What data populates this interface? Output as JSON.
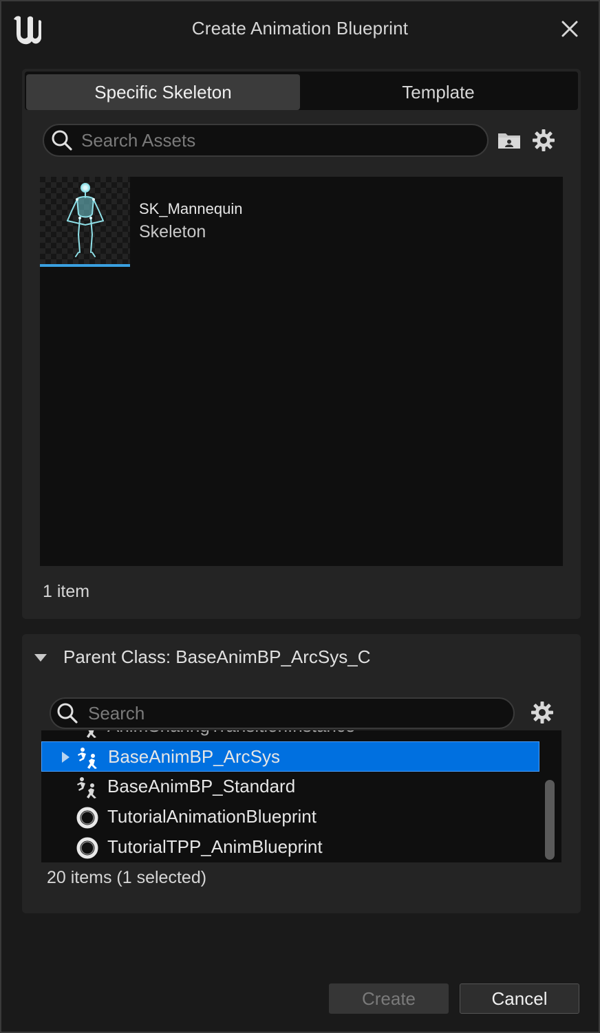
{
  "window": {
    "title": "Create Animation Blueprint"
  },
  "tabs": [
    {
      "label": "Specific Skeleton",
      "active": true
    },
    {
      "label": "Template",
      "active": false
    }
  ],
  "asset_picker": {
    "search_placeholder": "Search Assets",
    "assets": [
      {
        "name": "SK_Mannequin",
        "type": "Skeleton",
        "icon": "mannequin-thumbnail"
      }
    ],
    "count_text": "1 item"
  },
  "parent_class": {
    "label": "Parent Class: BaseAnimBP_ArcSys_C",
    "search_placeholder": "Search",
    "items": [
      {
        "label": "AnimSharingTransitionInstance",
        "icon": "anim-blueprint-icon"
      },
      {
        "label": "BaseAnimBP_ArcSys",
        "icon": "anim-blueprint-icon",
        "selected": true,
        "expandable": true
      },
      {
        "label": "BaseAnimBP_Standard",
        "icon": "anim-blueprint-icon"
      },
      {
        "label": "TutorialAnimationBlueprint",
        "icon": "ring-icon"
      },
      {
        "label": "TutorialTPP_AnimBlueprint",
        "icon": "ring-icon"
      }
    ],
    "count_text": "20 items (1 selected)"
  },
  "footer": {
    "create_label": "Create",
    "cancel_label": "Cancel"
  },
  "colors": {
    "selection": "#0070e0",
    "accent_underline": "#3aa0e0",
    "background": "#1a1a1a"
  }
}
